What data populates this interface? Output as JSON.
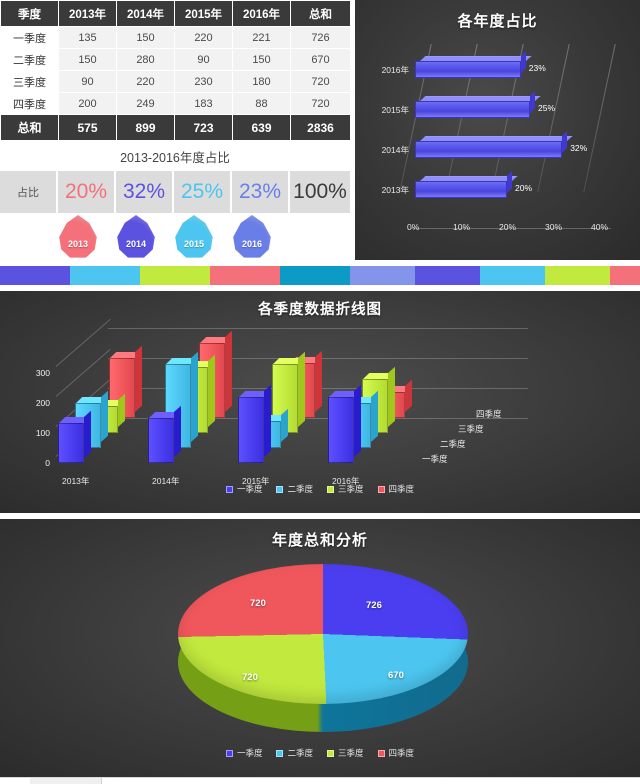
{
  "table": {
    "headers": [
      "季度",
      "2013年",
      "2014年",
      "2015年",
      "2016年",
      "总和"
    ],
    "rows": [
      {
        "label": "一季度",
        "values": [
          "135",
          "150",
          "220",
          "221"
        ],
        "total": "726"
      },
      {
        "label": "二季度",
        "values": [
          "150",
          "280",
          "90",
          "150"
        ],
        "total": "670"
      },
      {
        "label": "三季度",
        "values": [
          "90",
          "220",
          "230",
          "180"
        ],
        "total": "720"
      },
      {
        "label": "四季度",
        "values": [
          "200",
          "249",
          "183",
          "88"
        ],
        "total": "720"
      }
    ],
    "total_row": {
      "label": "总和",
      "values": [
        "575",
        "899",
        "723",
        "639"
      ],
      "total": "2836"
    }
  },
  "ratio": {
    "title": "2013-2016年度占比",
    "row_label": "占比",
    "items": [
      {
        "year": "2013",
        "percent": "20%",
        "color": "#f4707a"
      },
      {
        "year": "2014",
        "percent": "32%",
        "color": "#5b52e0"
      },
      {
        "year": "2015",
        "percent": "25%",
        "color": "#4cc6f0"
      },
      {
        "year": "2016",
        "percent": "23%",
        "color": "#6a7ee8"
      }
    ],
    "grand_total": "100%"
  },
  "hbar_chart": {
    "title": "各年度占比",
    "accent": "#5858ec"
  },
  "column_chart": {
    "title": "各季度数据折线图",
    "legend": [
      "一季度",
      "二季度",
      "三季度",
      "四季度"
    ],
    "legend_colors": [
      "#4b3ef0",
      "#4cc6f0",
      "#c2e93e",
      "#f0575c"
    ],
    "z_labels": [
      "一季度",
      "二季度",
      "三季度",
      "四季度"
    ]
  },
  "pie_chart": {
    "title": "年度总和分析",
    "legend": [
      "一季度",
      "二季度",
      "三季度",
      "四季度"
    ],
    "legend_colors": [
      "#4b3ef0",
      "#4cc6f0",
      "#c2e93e",
      "#f0575c"
    ]
  },
  "stripe_colors": [
    "#5b52e0",
    "#4cc6f0",
    "#c2e93e",
    "#f4707a",
    "#0b9bc4",
    "#8494ea",
    "#5b52e0",
    "#4cc6f0",
    "#c2e93e",
    "#f4707a",
    "#0b9bc4"
  ],
  "chart_data": [
    {
      "type": "bar",
      "id": "yearly-share-bar",
      "title": "各年度占比",
      "orientation": "horizontal",
      "categories": [
        "2013年",
        "2014年",
        "2015年",
        "2016年"
      ],
      "values": [
        20,
        32,
        25,
        23
      ],
      "data_labels": [
        "20%",
        "25%",
        "32%",
        "23%"
      ],
      "xlabel": "",
      "ylabel": "",
      "xtick_labels": [
        "0%",
        "10%",
        "20%",
        "30%",
        "40%"
      ],
      "xlim": [
        0,
        40
      ],
      "grid": true,
      "legend": "none",
      "series_color": "#5858ec"
    },
    {
      "type": "bar",
      "id": "quarterly-3d-columns",
      "title": "各季度数据折线图",
      "subtype": "3d-column",
      "categories": [
        "2013年",
        "2014年",
        "2015年",
        "2016年"
      ],
      "series": [
        {
          "name": "一季度",
          "values": [
            135,
            150,
            220,
            221
          ],
          "color": "#4b3ef0"
        },
        {
          "name": "二季度",
          "values": [
            150,
            280,
            90,
            150
          ],
          "color": "#4cc6f0"
        },
        {
          "name": "三季度",
          "values": [
            90,
            220,
            230,
            180
          ],
          "color": "#c2e93e"
        },
        {
          "name": "四季度",
          "values": [
            200,
            249,
            183,
            88
          ],
          "color": "#f0575c"
        }
      ],
      "ytick_labels": [
        "0",
        "100",
        "200",
        "300"
      ],
      "ylim": [
        0,
        300
      ],
      "xlabel": "",
      "ylabel": "",
      "grid": true,
      "legend_position": "bottom"
    },
    {
      "type": "pie",
      "id": "annual-total-pie",
      "title": "年度总和分析",
      "subtype": "3d-pie",
      "labels": [
        "一季度",
        "二季度",
        "三季度",
        "四季度"
      ],
      "values": [
        726,
        670,
        720,
        720
      ],
      "data_labels": [
        "726",
        "670",
        "720",
        "720"
      ],
      "colors": [
        "#4b3ef0",
        "#4cc6f0",
        "#c2e93e",
        "#f0575c"
      ],
      "legend_position": "bottom",
      "total": 2836
    }
  ]
}
